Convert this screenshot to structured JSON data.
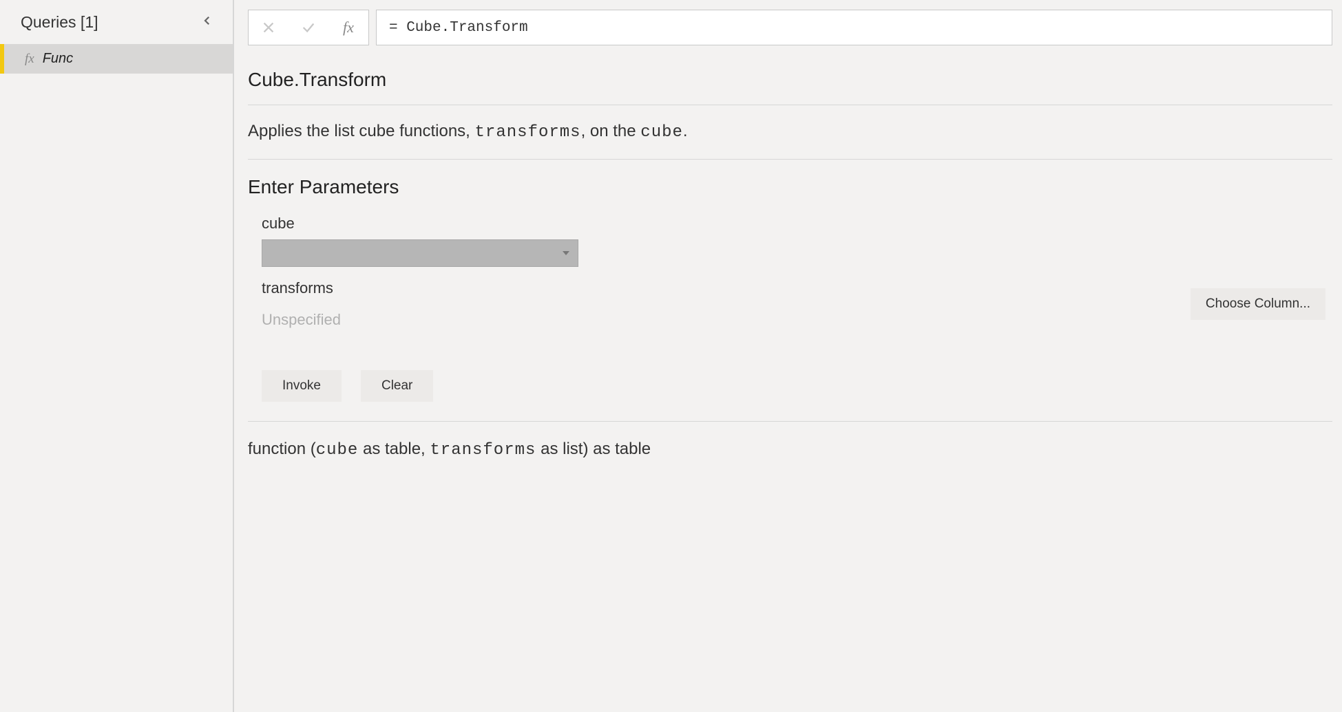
{
  "sidebar": {
    "title": "Queries [1]",
    "items": [
      {
        "icon": "fx",
        "name": "Func"
      }
    ]
  },
  "formula_bar": {
    "value": "= Cube.Transform"
  },
  "function": {
    "name": "Cube.Transform",
    "desc_prefix": "Applies the list cube functions, ",
    "desc_param1": "transforms",
    "desc_mid": ", on the ",
    "desc_param2": "cube",
    "desc_suffix": ".",
    "params_title": "Enter Parameters",
    "params": {
      "cube": {
        "label": "cube"
      },
      "transforms": {
        "label": "transforms",
        "value_placeholder": "Unspecified"
      }
    },
    "choose_column_label": "Choose Column...",
    "invoke_label": "Invoke",
    "clear_label": "Clear",
    "signature": {
      "pre": "function (",
      "p1": "cube",
      "p1_type": " as table, ",
      "p2": "transforms",
      "p2_type": " as list) as table"
    }
  }
}
